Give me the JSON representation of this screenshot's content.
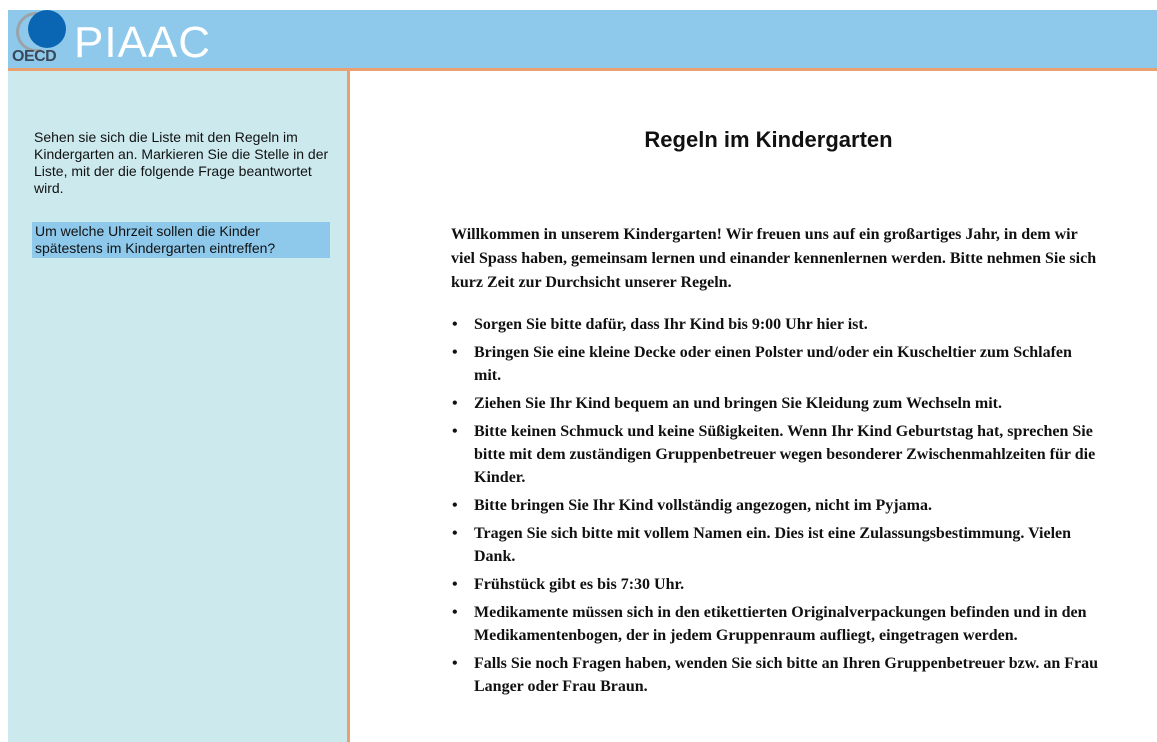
{
  "header": {
    "logo_text": "OECD",
    "brand": "PIAAC"
  },
  "sidebar": {
    "instructions": "Sehen sie sich die Liste mit den Regeln im Kindergarten an. Markieren Sie die Stelle in der Liste, mit der die folgende Frage beantwortet wird.",
    "question": "Um welche Uhrzeit sollen die Kinder spätestens im Kindergarten eintreffen?"
  },
  "main": {
    "title": "Regeln im Kindergarten",
    "intro": "Willkommen in unserem Kindergarten! Wir freuen uns auf ein großartiges Jahr, in dem wir viel Spass haben, gemeinsam lernen und einander kennenlernen werden. Bitte nehmen Sie sich kurz Zeit zur Durchsicht unserer Regeln.",
    "bullet_symbol": "•",
    "rules": [
      "Sorgen Sie bitte dafür, dass Ihr Kind bis 9:00 Uhr hier ist.",
      "Bringen Sie eine kleine Decke oder einen Polster und/oder ein Kuscheltier zum Schlafen mit.",
      "Ziehen Sie Ihr Kind bequem an und bringen Sie Kleidung zum Wechseln mit.",
      "Bitte keinen Schmuck und keine Süßigkeiten. Wenn Ihr Kind Geburtstag hat, sprechen Sie bitte mit dem zuständigen Gruppenbetreuer wegen besonderer Zwischenmahlzeiten für die Kinder.",
      "Bitte bringen Sie Ihr Kind vollständig angezogen, nicht im Pyjama.",
      "Tragen Sie sich bitte mit vollem Namen ein. Dies ist eine Zulassungsbestimmung. Vielen Dank.",
      "Frühstück gibt es bis 7:30 Uhr.",
      "Medikamente müssen sich in den etikettierten Originalverpackungen befinden und in den Medikamentenbogen, der in jedem Gruppenraum aufliegt, eingetragen werden.",
      "Falls Sie noch Fragen haben, wenden Sie sich bitte an Ihren Gruppenbetreuer bzw. an Frau Langer oder Frau Braun."
    ]
  }
}
